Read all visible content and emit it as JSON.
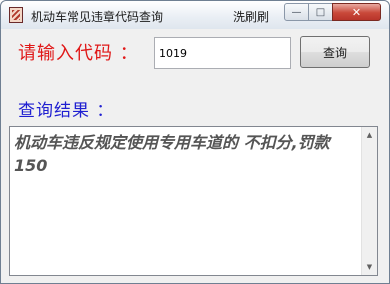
{
  "window": {
    "title": "机动车常见违章代码查询",
    "title_extra": "洗刷刷",
    "controls": {
      "minimize": "—",
      "maximize": "□",
      "close": "✕"
    }
  },
  "form": {
    "input_label": "请输入代码 ：",
    "code_value": "1019",
    "query_button": "查询"
  },
  "result": {
    "label": "查询结果 ：",
    "text": "机动车违反规定使用专用车道的 不扣分,罚款150"
  },
  "scrollbar": {
    "up": "▲",
    "down": "▼"
  }
}
